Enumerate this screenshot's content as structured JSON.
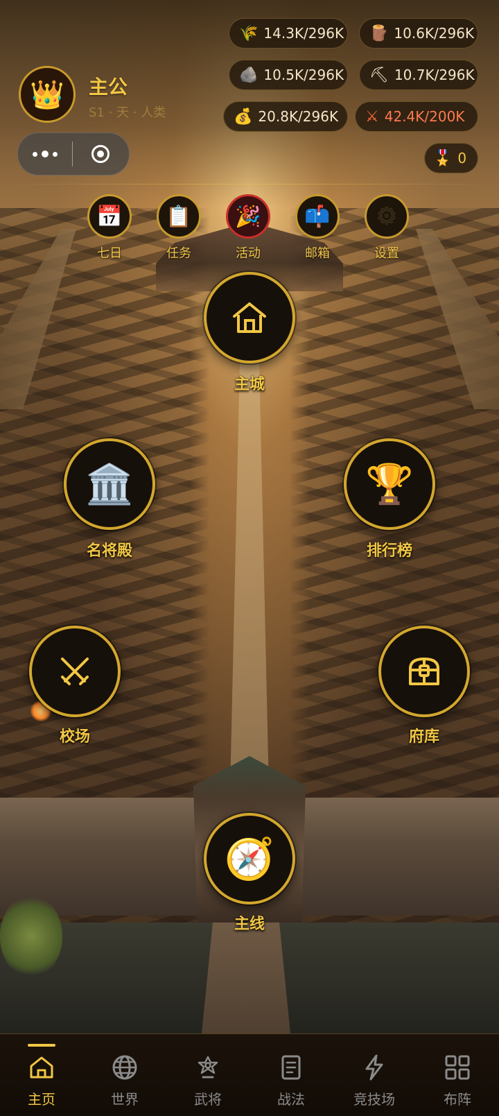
{
  "player": {
    "avatar_icon": "crown-icon",
    "name": "主公",
    "subtitle": "S1 · 天 · 人类"
  },
  "resources": [
    {
      "icon": "grain-icon",
      "glyph": "🌾",
      "value": "14.3K/296K"
    },
    {
      "icon": "wood-icon",
      "glyph": "🪵",
      "value": "10.6K/296K"
    },
    {
      "icon": "stone-icon",
      "glyph": "🪨",
      "value": "10.5K/296K"
    },
    {
      "icon": "pickaxe-icon",
      "glyph": "⛏",
      "value": "10.7K/296K"
    },
    {
      "icon": "money-bag-icon",
      "glyph": "💰",
      "value": "20.8K/296K"
    },
    {
      "icon": "crossed-swords-icon",
      "glyph": "⚔",
      "value": "42.4K/200K"
    }
  ],
  "medal": {
    "icon": "medal-icon",
    "glyph": "🎖️",
    "value": "0"
  },
  "quick_menu": [
    {
      "icon": "calendar-icon",
      "glyph": "📅",
      "label": "七日"
    },
    {
      "icon": "clipboard-icon",
      "glyph": "📋",
      "label": "任务"
    },
    {
      "icon": "party-popper-icon",
      "glyph": "🎉",
      "label": "活动"
    },
    {
      "icon": "mailbox-icon",
      "glyph": "📫",
      "label": "邮箱"
    },
    {
      "icon": "gear-icon",
      "glyph": "⚙",
      "label": "设置"
    }
  ],
  "buildings": {
    "main_city": {
      "icon": "house-icon",
      "label": "主城"
    },
    "hall_of_generals": {
      "icon": "classical-building-icon",
      "glyph": "🏛️",
      "label": "名将殿"
    },
    "leaderboard": {
      "icon": "trophy-icon",
      "glyph": "🏆",
      "label": "排行榜"
    },
    "training_ground": {
      "icon": "crossed-swords-icon",
      "label": "校场"
    },
    "treasury": {
      "icon": "treasure-chest-icon",
      "label": "府库"
    },
    "main_quest": {
      "icon": "compass-icon",
      "glyph": "🧭",
      "label": "主线"
    }
  },
  "bottom_nav": [
    {
      "icon": "home-icon",
      "label": "主页",
      "active": true
    },
    {
      "icon": "globe-icon",
      "label": "世界",
      "active": false
    },
    {
      "icon": "general-badge-icon",
      "label": "武将",
      "active": false
    },
    {
      "icon": "scroll-icon",
      "label": "战法",
      "active": false
    },
    {
      "icon": "lightning-icon",
      "label": "竞技场",
      "active": false
    },
    {
      "icon": "grid-icon",
      "label": "布阵",
      "active": false
    }
  ],
  "colors": {
    "accent_gold": "#f2c744",
    "ring_gold": "#d3a72e",
    "alert_red": "#ff7a50",
    "nav_inactive": "#8b8b8b"
  }
}
